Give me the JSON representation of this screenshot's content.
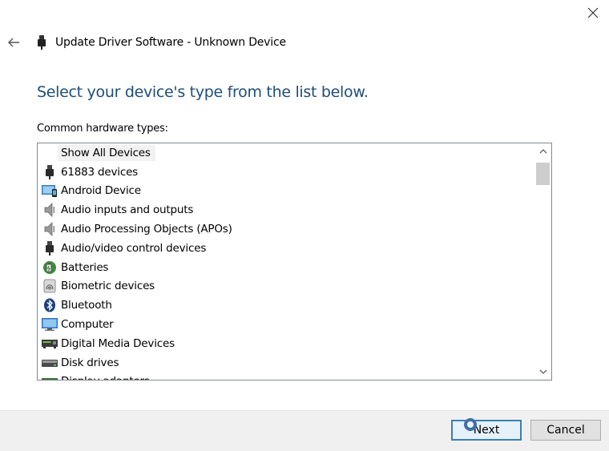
{
  "window": {
    "title": "Update Driver Software - Unknown Device"
  },
  "main": {
    "heading": "Select your device's type from the list below.",
    "list_label": "Common hardware types:"
  },
  "list": {
    "items": [
      {
        "label": "Show All Devices",
        "icon": "none"
      },
      {
        "label": "61883 devices",
        "icon": "usb-plug-icon"
      },
      {
        "label": "Android Device",
        "icon": "monitor-phone-icon"
      },
      {
        "label": "Audio inputs and outputs",
        "icon": "speaker-icon"
      },
      {
        "label": "Audio Processing Objects (APOs)",
        "icon": "speaker-icon"
      },
      {
        "label": "Audio/video control devices",
        "icon": "usb-plug-icon"
      },
      {
        "label": "Batteries",
        "icon": "battery-icon"
      },
      {
        "label": "Biometric devices",
        "icon": "fingerprint-icon"
      },
      {
        "label": "Bluetooth",
        "icon": "bluetooth-icon"
      },
      {
        "label": "Computer",
        "icon": "monitor-icon"
      },
      {
        "label": "Digital Media Devices",
        "icon": "media-device-icon"
      },
      {
        "label": "Disk drives",
        "icon": "disk-drive-icon"
      },
      {
        "label": "Display adapters",
        "icon": "display-adapter-icon"
      }
    ]
  },
  "footer": {
    "next_label": "Next",
    "cancel_label": "Cancel"
  },
  "colors": {
    "heading": "#1e4e79",
    "accent": "#3c7fb1"
  }
}
